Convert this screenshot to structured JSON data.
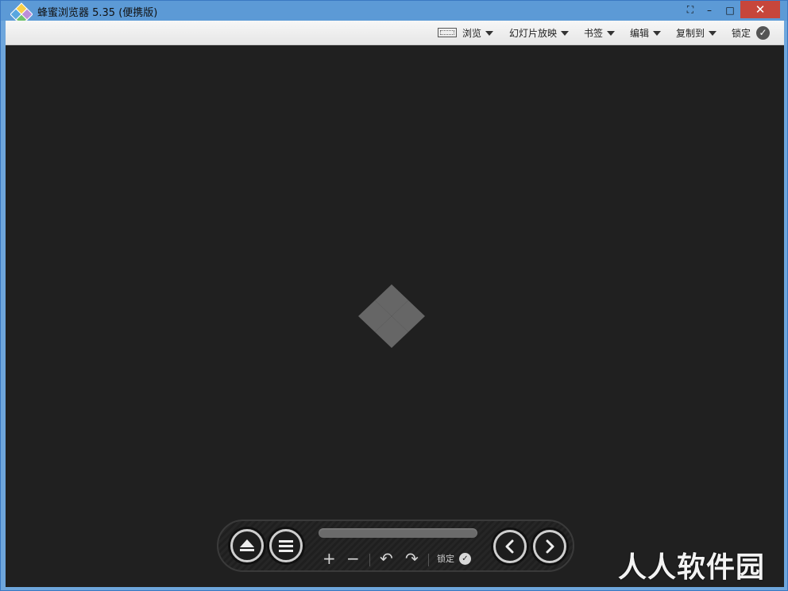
{
  "window": {
    "title": "蜂蜜浏览器 5.35 (便携版)",
    "close_glyph": "✕",
    "minimize_glyph": "–",
    "maximize_glyph": "□",
    "fullscreen_glyph": "⛶"
  },
  "toolbar": {
    "items": [
      {
        "label": "浏览"
      },
      {
        "label": "幻灯片放映"
      },
      {
        "label": "书签"
      },
      {
        "label": "编辑"
      },
      {
        "label": "复制到"
      },
      {
        "label": "锁定"
      }
    ],
    "check_glyph": "✓"
  },
  "controls": {
    "zoom_in": "+",
    "zoom_out": "−",
    "rotate_left": "↶",
    "rotate_right": "↷",
    "lock_label": "锁定",
    "check_glyph": "✓",
    "progress_value": 0
  },
  "watermark": {
    "text": "人人软件园"
  },
  "colors": {
    "titlebar": "#5c9ad6",
    "close": "#c7463b",
    "viewer_bg": "#202020",
    "logo_gray": "#666666"
  }
}
